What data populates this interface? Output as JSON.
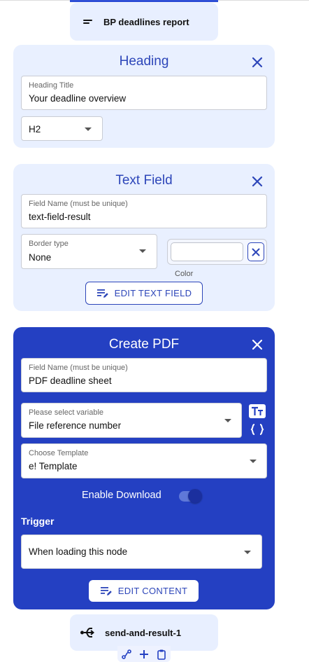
{
  "top_node": {
    "label": "BP deadlines report",
    "icon": "lines-icon"
  },
  "heading_card": {
    "title": "Heading",
    "title_field": {
      "label": "Heading Title",
      "value": "Your deadline overview"
    },
    "level_select": {
      "value": "H2"
    }
  },
  "text_field_card": {
    "title": "Text Field",
    "name_field": {
      "label": "Field Name (must be unique)",
      "value": "text-field-result"
    },
    "border_select": {
      "label": "Border type",
      "value": "None"
    },
    "color_label": "Color",
    "edit_button": "EDIT TEXT FIELD"
  },
  "pdf_card": {
    "title": "Create PDF",
    "name_field": {
      "label": "Field Name (must be unique)",
      "value": "PDF deadline sheet"
    },
    "variable_select": {
      "label": "Please select variable",
      "value": "File reference number"
    },
    "template_select": {
      "label": "Choose Template",
      "value": "e! Template"
    },
    "download_label": "Enable Download",
    "download_enabled": true,
    "trigger_label": "Trigger",
    "trigger_select": {
      "value": "When loading this node"
    },
    "edit_button": "EDIT CONTENT"
  },
  "bottom_node": {
    "label": "send-and-result-1",
    "icon": "split-arrow-icon"
  },
  "theme": {
    "accent": "#2440c2",
    "card_bg": "#e9f0ff",
    "node_bg": "#e8efff"
  }
}
